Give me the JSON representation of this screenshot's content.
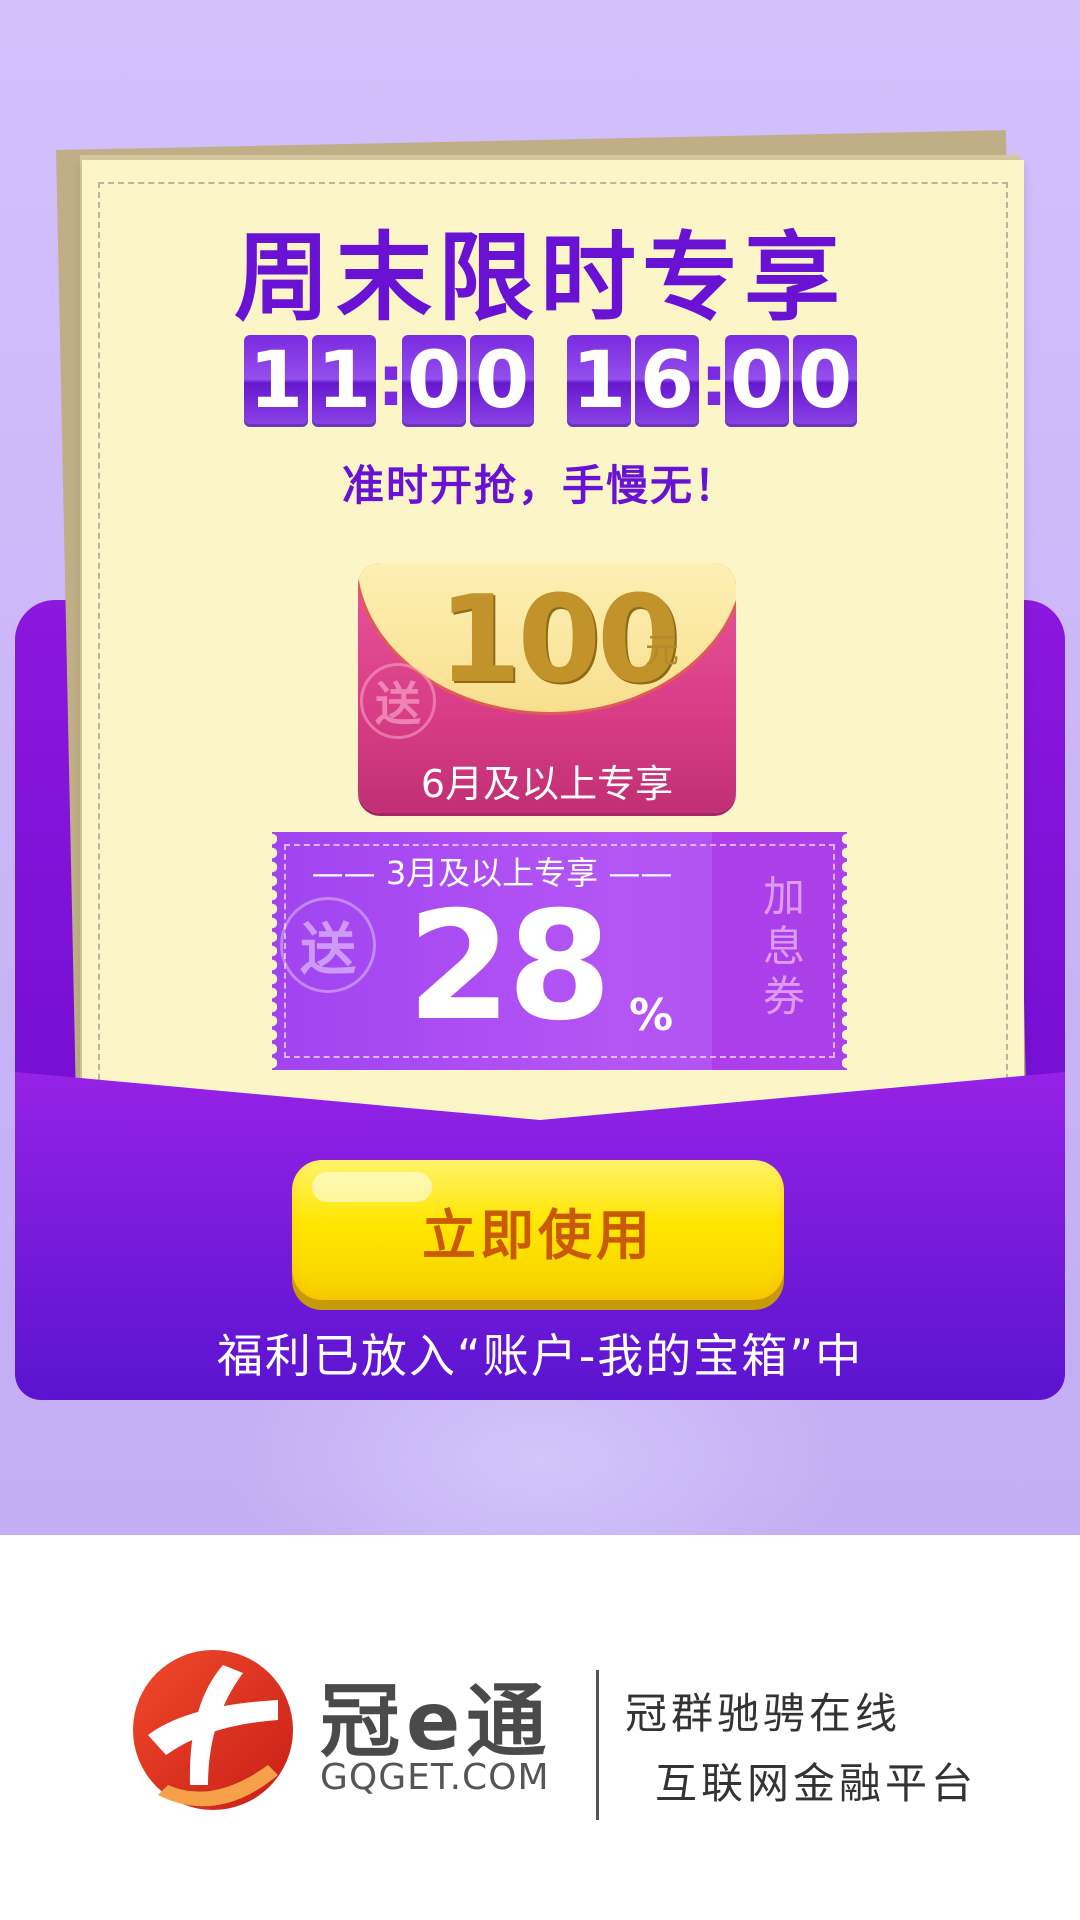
{
  "promo": {
    "headline": "周末限时专享",
    "times": [
      {
        "digits": [
          "1",
          "1"
        ],
        "minutes": [
          "0",
          "0"
        ]
      },
      {
        "digits": [
          "1",
          "6"
        ],
        "minutes": [
          "0",
          "0"
        ]
      }
    ],
    "subline": "准时开抢，手慢无！",
    "red_packet": {
      "amount": "100",
      "unit": "元",
      "send_badge": "送",
      "note": "6月及以上专享"
    },
    "coupon": {
      "header": "—— 3月及以上专享 ——",
      "value": "28",
      "percent": "%",
      "send_badge": "送",
      "type_label": [
        "加",
        "息",
        "券"
      ]
    },
    "cta_label": "立即使用",
    "footer_note": "福利已放入“账户-我的宝箱”中"
  },
  "brand": {
    "name": "冠e通",
    "url": "GQGET.COM",
    "slogan_line1": "冠群驰骋在线",
    "slogan_line2": "互联网金融平台"
  },
  "colors": {
    "background": "#d3c0fb",
    "accent_purple": "#6a12d4",
    "envelope": "#7a10d6",
    "paper": "#fcf5c8",
    "red_packet": "#d83d86",
    "coupon": "#a044f0",
    "cta_yellow": "#ffe600",
    "cta_text": "#c95a07",
    "logo_red": "#e8382a"
  }
}
